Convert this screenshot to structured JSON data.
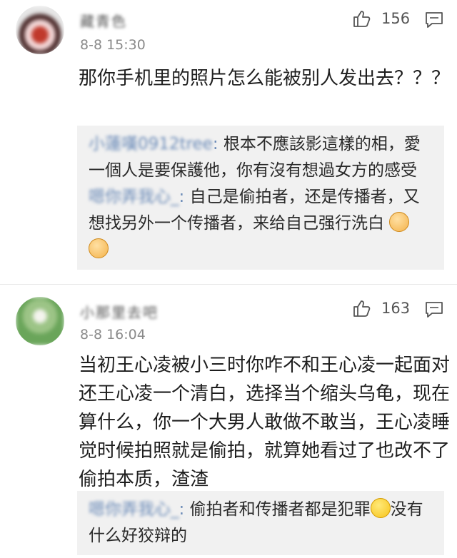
{
  "comments": [
    {
      "username": "藏青色",
      "time": "8-8 15:30",
      "likes": "156",
      "text": "那你手机里的照片怎么能被别人发出去？？？",
      "replies": [
        {
          "name": "小蓮嘆0912tree",
          "text": "根本不應該影這樣的相，愛一個人是要保護他，你有沒有想過女方的感受"
        },
        {
          "name": "嗯你弄我心_",
          "text": "自己是偷拍者，还是传播者，又想找另外一个传播者，来给自己强行洗白"
        }
      ]
    },
    {
      "username": "小那里去吧",
      "time": "8-8 16:04",
      "likes": "163",
      "text": "当初王心凌被小三时你咋不和王心凌一起面对还王心凌一个清白，选择当个缩头乌龟，现在算什么，你一个大男人敢做不敢当，王心凌睡觉时候拍照就是偷拍，就算她看过了也改不了偷拍本质，渣渣",
      "replies": [
        {
          "name": "嗯你弄我心_",
          "text": "偷拍者和传播者都是犯罪"
        },
        {
          "name": "",
          "text": "没有什么好狡辩的"
        }
      ]
    }
  ],
  "icons": {
    "like": "thumbs-up-icon",
    "reply": "comment-bubble-icon"
  },
  "colors": {
    "reply_name": "#6b8bb8",
    "reply_bg": "#f1f1f1",
    "meta": "#8a8a8a"
  }
}
